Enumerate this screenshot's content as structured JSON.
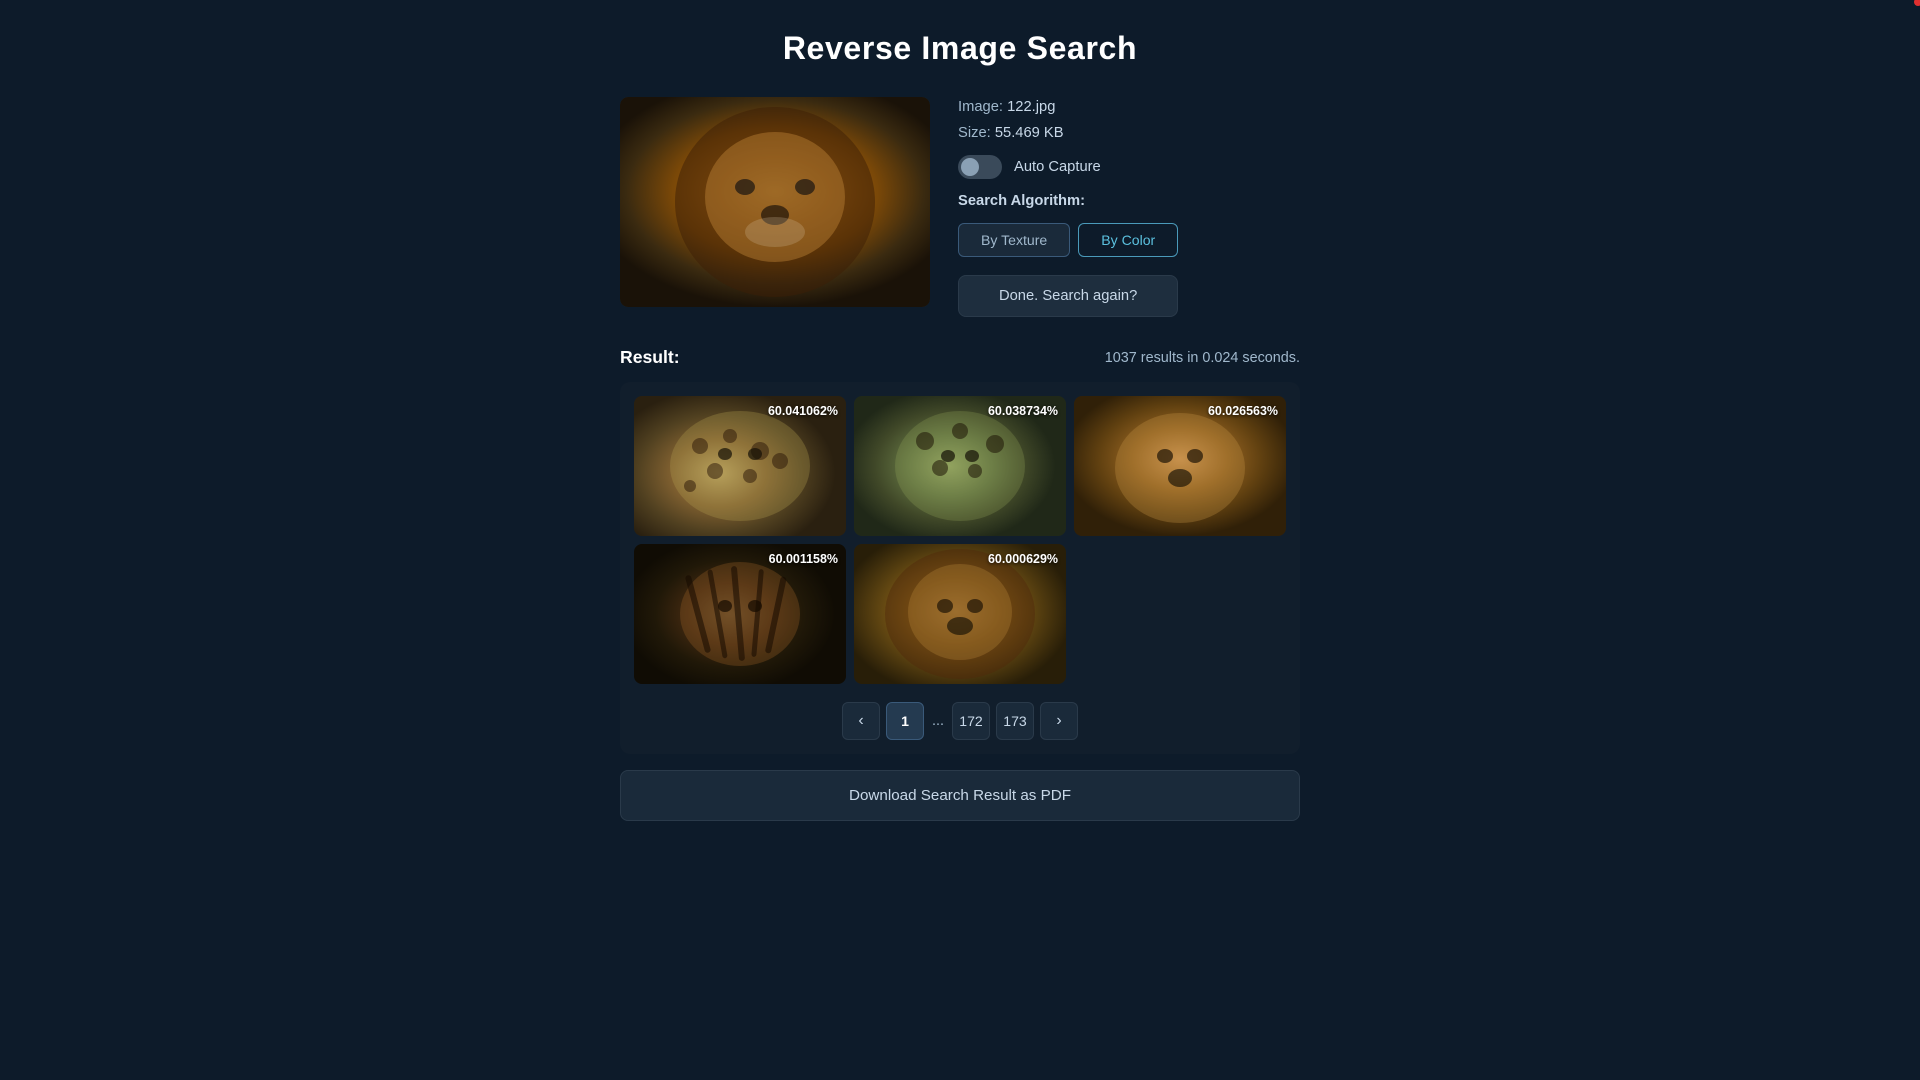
{
  "page": {
    "title": "Reverse Image Search"
  },
  "image_info": {
    "filename_label": "Image:",
    "filename": "122.jpg",
    "size_label": "Size:",
    "size": "55.469 KB",
    "auto_capture_label": "Auto Capture",
    "search_algorithm_label": "Search Algorithm:"
  },
  "buttons": {
    "by_texture": "By Texture",
    "by_color": "By Color",
    "search_again": "Done. Search again?",
    "download": "Download Search Result as PDF"
  },
  "results": {
    "label": "Result:",
    "count_text": "1037 results in 0.024 seconds."
  },
  "result_items": [
    {
      "score": "60.041062%",
      "animal_class": "animal-1"
    },
    {
      "score": "60.038734%",
      "animal_class": "animal-2"
    },
    {
      "score": "60.026563%",
      "animal_class": "animal-3"
    },
    {
      "score": "60.001158%",
      "animal_class": "animal-4"
    },
    {
      "score": "60.000629%",
      "animal_class": "animal-5"
    }
  ],
  "pagination": {
    "prev_label": "‹",
    "next_label": "›",
    "pages": [
      "1",
      "172",
      "173"
    ],
    "dots": "...",
    "active_page": "1"
  }
}
